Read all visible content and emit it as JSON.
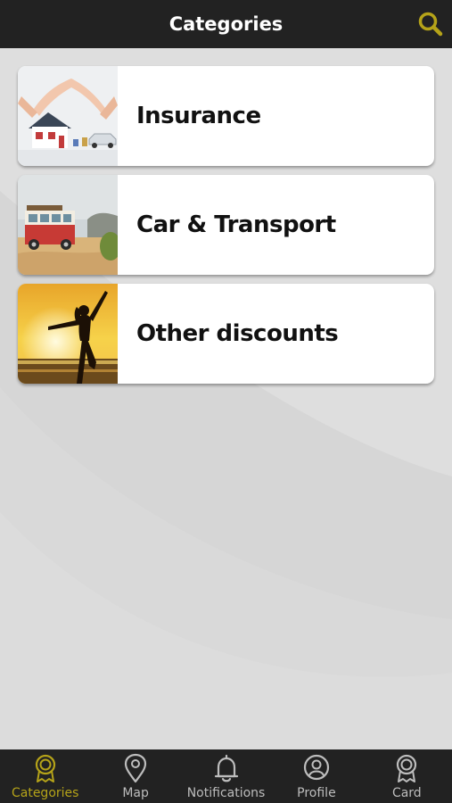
{
  "header": {
    "title": "Categories",
    "search_icon": "search-icon"
  },
  "categories": [
    {
      "label": "Insurance",
      "image": "house-protected-by-hands"
    },
    {
      "label": "Car & Transport",
      "image": "vintage-van-on-beach"
    },
    {
      "label": "Other discounts",
      "image": "woman-jumping-at-sunset-beach"
    }
  ],
  "tabbar": {
    "active": "Categories",
    "tabs": [
      {
        "label": "Categories",
        "icon": "badge-icon"
      },
      {
        "label": "Map",
        "icon": "map-pin-icon"
      },
      {
        "label": "Notifications",
        "icon": "bell-icon"
      },
      {
        "label": "Profile",
        "icon": "profile-icon"
      },
      {
        "label": "Card",
        "icon": "badge-icon"
      }
    ]
  },
  "colors": {
    "bar": "#222222",
    "accent": "#b5a319",
    "background": "#dcdcdc",
    "card": "#ffffff",
    "inactive_tab": "#bdbdbd"
  }
}
